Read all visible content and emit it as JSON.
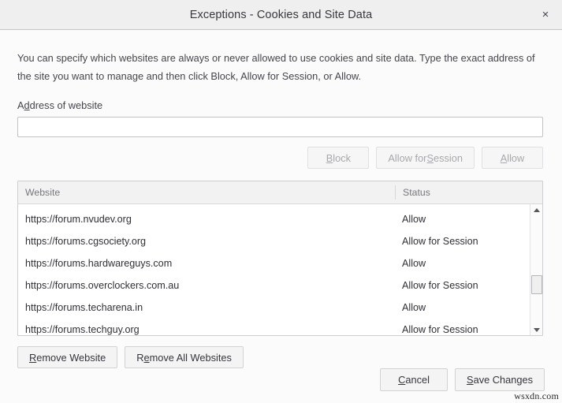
{
  "window": {
    "title": "Exceptions - Cookies and Site Data",
    "close_icon": "close-icon",
    "close_glyph": "×"
  },
  "description": "You can specify which websites are always or never allowed to use cookies and site data. Type the exact address of the site you want to manage and then click Block, Allow for Session, or Allow.",
  "address_field": {
    "label_prefix": "A",
    "label_accesskey": "d",
    "label_suffix": "dress of website",
    "value": "",
    "placeholder": ""
  },
  "permission_buttons": [
    {
      "name": "block-button",
      "prefix": "",
      "accesskey": "B",
      "suffix": "lock",
      "disabled": true
    },
    {
      "name": "allow-for-session-button",
      "prefix": "Allow for ",
      "accesskey": "S",
      "suffix": "ession",
      "disabled": true
    },
    {
      "name": "allow-button",
      "prefix": "",
      "accesskey": "A",
      "suffix": "llow",
      "disabled": true
    }
  ],
  "table": {
    "columns": [
      "Website",
      "Status"
    ],
    "rows": [
      {
        "website": "https://forum.nvudev.org",
        "status": "Allow"
      },
      {
        "website": "https://forums.cgsociety.org",
        "status": "Allow for Session"
      },
      {
        "website": "https://forums.hardwareguys.com",
        "status": "Allow"
      },
      {
        "website": "https://forums.overclockers.com.au",
        "status": "Allow for Session"
      },
      {
        "website": "https://forums.techarena.in",
        "status": "Allow"
      },
      {
        "website": "https://forums.techguy.org",
        "status": "Allow for Session"
      }
    ],
    "scrollbar": {
      "up_icon": "scroll-up-arrow-icon",
      "down_icon": "scroll-down-arrow-icon",
      "thumb_position_percent": 55
    }
  },
  "remove_buttons": [
    {
      "name": "remove-website-button",
      "prefix": "",
      "accesskey": "R",
      "suffix": "emove Website",
      "disabled": false
    },
    {
      "name": "remove-all-websites-button",
      "prefix": "R",
      "accesskey": "e",
      "suffix": "move All Websites",
      "disabled": false
    }
  ],
  "footer_buttons": [
    {
      "name": "cancel-button",
      "prefix": "",
      "accesskey": "C",
      "suffix": "ancel",
      "disabled": false
    },
    {
      "name": "save-changes-button",
      "prefix": "",
      "accesskey": "S",
      "suffix": "ave Changes",
      "disabled": false
    }
  ],
  "watermark": "wsxdn.com"
}
